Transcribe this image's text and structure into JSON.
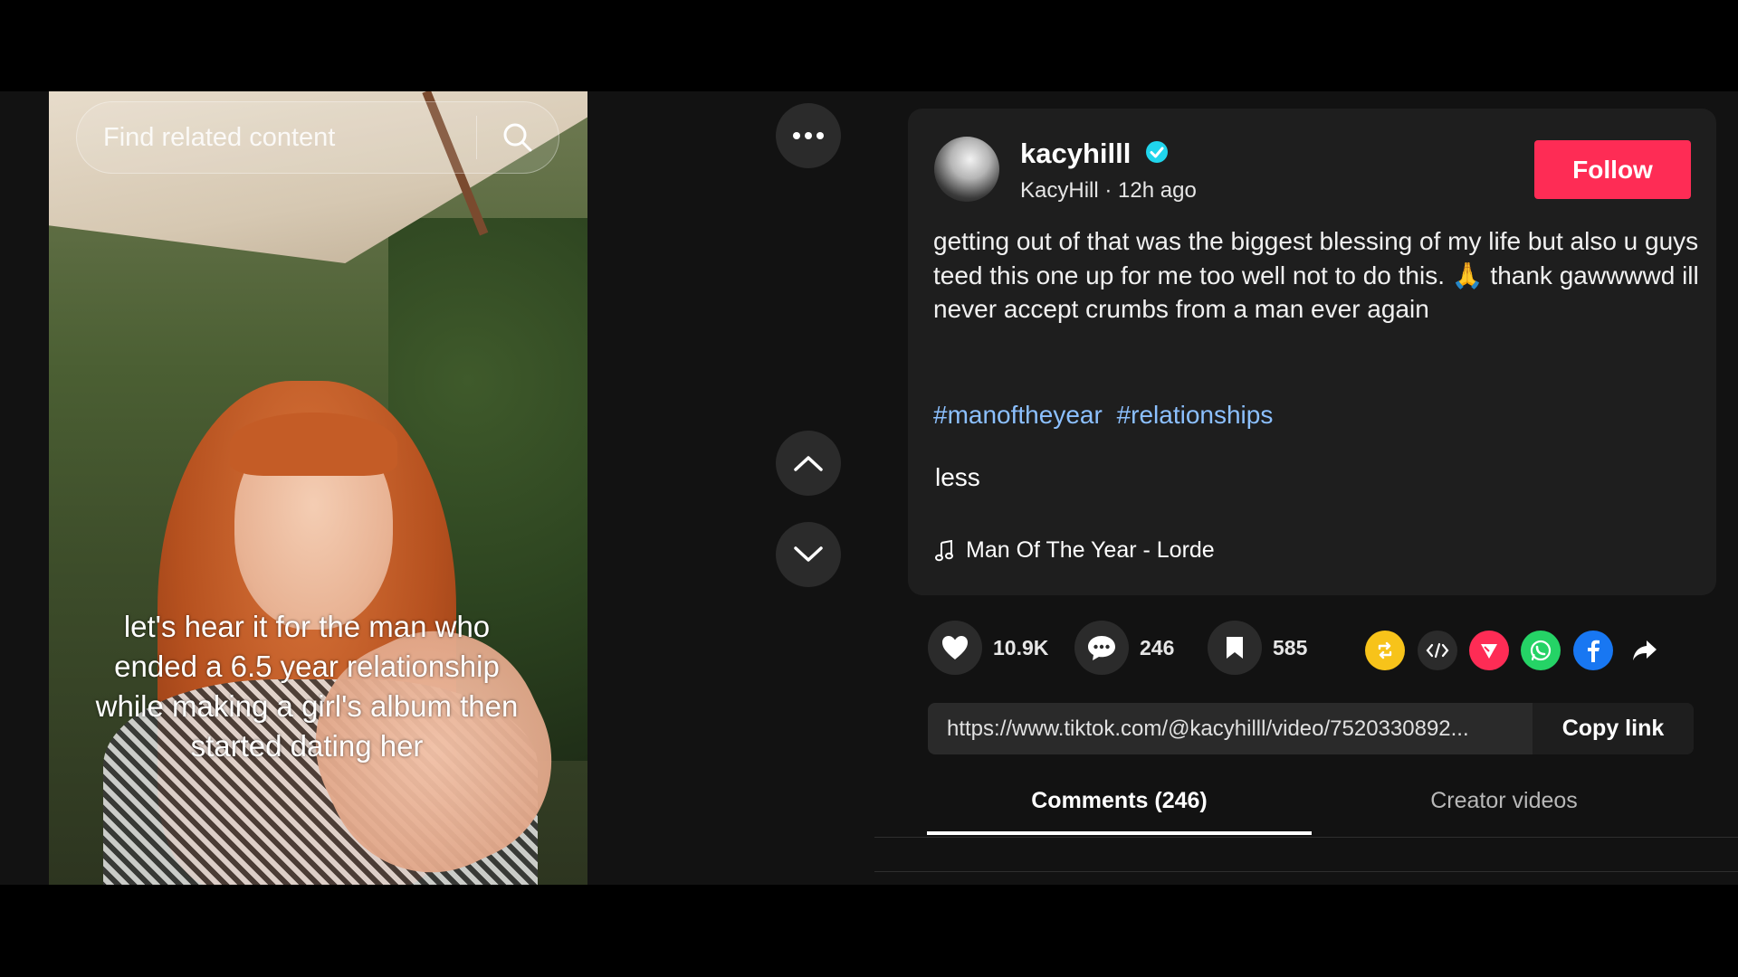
{
  "video": {
    "search_placeholder": "Find related content",
    "caption": "let's hear it for the man who ended a 6.5 year relationship while making a girl's album then started dating her"
  },
  "post": {
    "username": "kacyhilll",
    "display_name": "KacyHill",
    "time_ago": "12h ago",
    "follow_label": "Follow",
    "description": "getting out of that was the biggest blessing of my life but also u guys teed this one up for me too well not to do this. 🙏 thank gawwwwd ill never accept crumbs from a man ever again",
    "hashtags": [
      "#manoftheyear",
      "#relationships"
    ],
    "less_label": "less",
    "music": "Man Of The Year - Lorde"
  },
  "stats": {
    "likes": "10.9K",
    "comments": "246",
    "saves": "585"
  },
  "link": {
    "url": "https://www.tiktok.com/@kacyhilll/video/7520330892...",
    "copy_label": "Copy link"
  },
  "tabs": {
    "comments": "Comments (246)",
    "creator": "Creator videos"
  },
  "colors": {
    "follow": "#fe2c55",
    "hashtag": "#8cc0ff",
    "verified": "#20d5ec",
    "repost": "#f7c31a",
    "tiktok_share": "#fe2c55",
    "whatsapp": "#25d366",
    "facebook": "#1877f2"
  }
}
